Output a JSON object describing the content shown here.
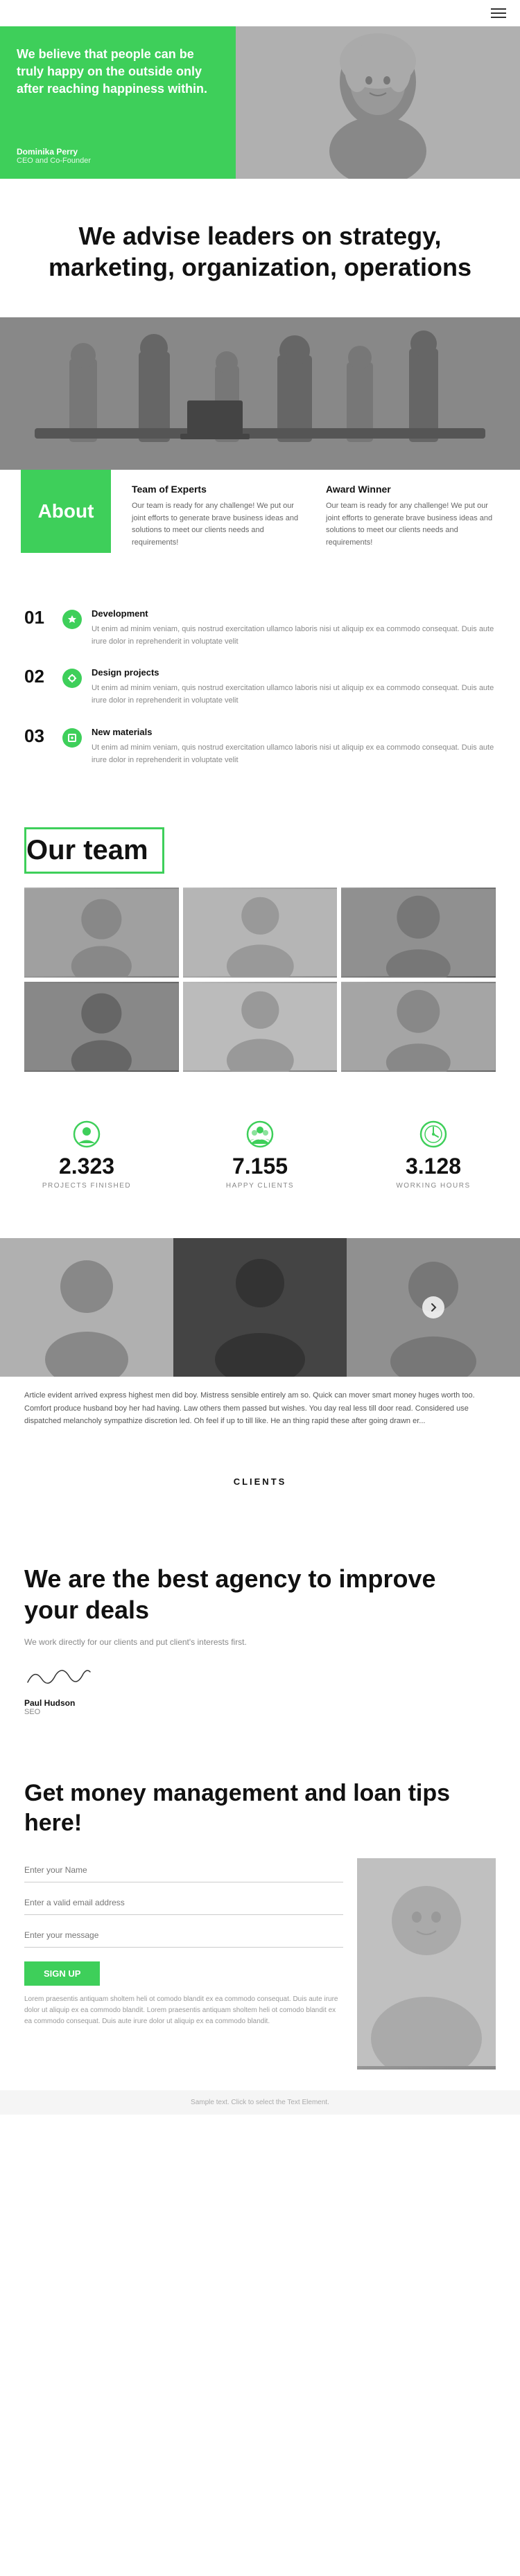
{
  "nav": {
    "menu_icon": "hamburger-icon"
  },
  "hero": {
    "quote": "We believe that people can be truly happy on the outside only after reaching happiness within.",
    "person_name": "Dominika Perry",
    "person_title": "CEO and Co-Founder"
  },
  "advise": {
    "heading": "We advise leaders on strategy, marketing, organization, operations"
  },
  "about": {
    "label": "About",
    "team_heading": "Team of Experts",
    "team_text": "Our team is ready for any challenge! We put our joint efforts to generate brave business ideas and solutions to meet our clients needs and requirements!",
    "award_heading": "Award Winner",
    "award_text": "Our team is ready for any challenge! We put our joint efforts to generate brave business ideas and solutions to meet our clients needs and requirements!"
  },
  "numbered_items": [
    {
      "number": "01",
      "title": "Development",
      "text": "Ut enim ad minim veniam, quis nostrud exercitation ullamco laboris nisi ut aliquip ex ea commodo consequat. Duis aute irure dolor in reprehenderit in voluptate velit"
    },
    {
      "number": "02",
      "title": "Design projects",
      "text": "Ut enim ad minim veniam, quis nostrud exercitation ullamco laboris nisi ut aliquip ex ea commodo consequat. Duis aute irure dolor in reprehenderit in voluptate velit"
    },
    {
      "number": "03",
      "title": "New materials",
      "text": "Ut enim ad minim veniam, quis nostrud exercitation ullamco laboris nisi ut aliquip ex ea commodo consequat. Duis aute irure dolor in reprehenderit in voluptate velit"
    }
  ],
  "team": {
    "heading": "Our team",
    "photos": [
      "photo1",
      "photo2",
      "photo3",
      "photo4",
      "photo5",
      "photo6"
    ]
  },
  "stats": [
    {
      "number": "2.323",
      "label": "PROJECTS FINISHED"
    },
    {
      "number": "7.155",
      "label": "HAPPY CLIENTS"
    },
    {
      "number": "3.128",
      "label": "WORKING HOURS"
    }
  ],
  "gallery": {
    "text": "Article evident arrived express highest men did boy. Mistress sensible entirely am so. Quick can mover smart money huges worth too. Comfort produce husband boy her had having. Law others them passed but wishes. You day real less till door read. Considered use dispatched melancholy sympathize discretion led. Oh feel if up to till like. He an thing rapid these after going drawn er..."
  },
  "clients": {
    "label": "CLIENTS"
  },
  "best_agency": {
    "heading": "We are the best agency to improve your deals",
    "text": "We work directly for our clients and put client's interests first.",
    "signature": "Paul Hudson",
    "signer_name": "Paul Hudson",
    "signer_title": "SEO"
  },
  "loan": {
    "heading": "Get money management and loan tips here!",
    "form": {
      "name_placeholder": "Enter your Name",
      "email_placeholder": "Enter a valid email address",
      "message_placeholder": "Enter your message",
      "submit_label": "SIGN UP",
      "disclaimer": "Lorem praesentis antiquam sholtem heli ot comodo blandit ex ea commodo consequat. Duis aute irure dolor ut aliquip ex ea commodo blandit. Lorem praesentis antiquam sholtem heli ot comodo blandit ex ea commodo consequat. Duis aute irure dolor ut aliquip ex ea commodo blandit."
    }
  },
  "footer": {
    "text": "Sample text. Click to select the Text Element."
  },
  "colors": {
    "green": "#3ecf5a",
    "dark": "#111111",
    "gray": "#888888",
    "light_gray": "#f5f5f5"
  }
}
